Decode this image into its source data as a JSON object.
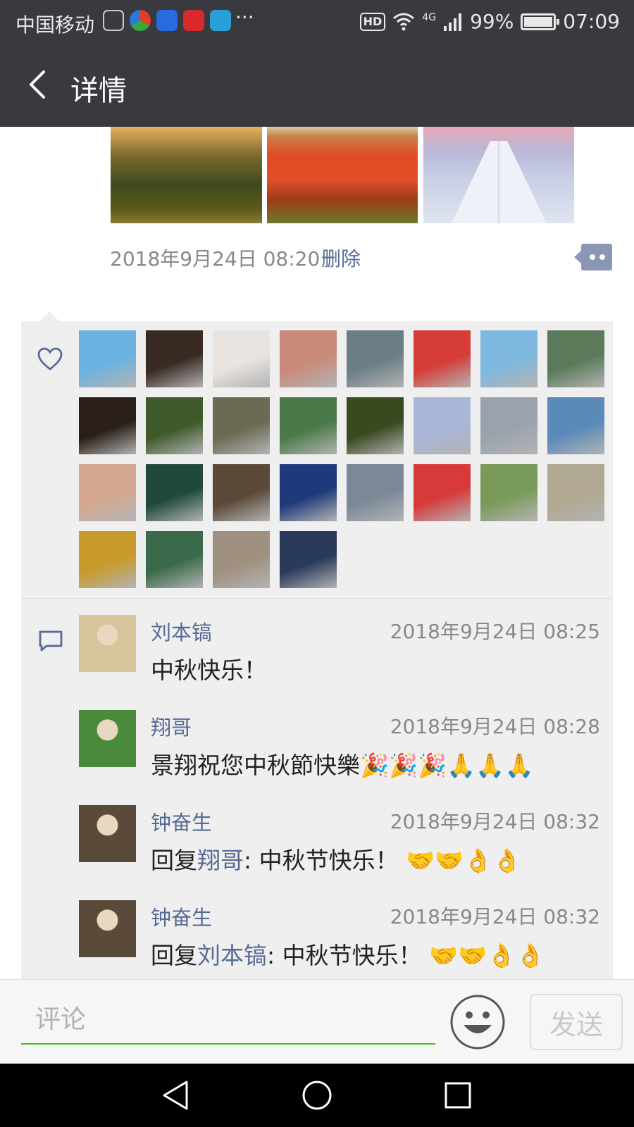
{
  "status_bar": {
    "carrier": "中国移动",
    "network_badge": "HD",
    "signal_label": "4G",
    "battery_percent": "99%",
    "battery_level": 0.99,
    "time": "07:09",
    "app_icons": [
      "vpn-icon",
      "browser-icon",
      "baidu-icon",
      "video-icon",
      "telegram-icon"
    ]
  },
  "header": {
    "title": "详情"
  },
  "moment": {
    "timestamp": "2018年9月24日 08:20",
    "delete_label": "删除"
  },
  "likes": {
    "avatars": [
      "#6ab3e0",
      "#3a2a24",
      "#e9e4e0",
      "#c98a7a",
      "#6b7d86",
      "#d63c38",
      "#7fb8de",
      "#5b7a5a",
      "#2a1f18",
      "#3f5a2a",
      "#6b6a55",
      "#4a7a4a",
      "#3a4a20",
      "#a9b6d8",
      "#9aa3ad",
      "#5a8ab8",
      "#d4a890",
      "#1f4a3a",
      "#5a4838",
      "#1e3a7a",
      "#7a8898",
      "#d83a3a",
      "#7a9a5a",
      "#b0a890",
      "#c89a2a",
      "#3a6a4a",
      "#a09080",
      "#2a3a5a"
    ]
  },
  "comments": [
    {
      "name": "刘本镐",
      "time": "2018年9月24日 08:25",
      "text": "中秋快乐！",
      "avatar_color": "#d8c49a"
    },
    {
      "name": "翔哥",
      "time": "2018年9月24日 08:28",
      "text": "景翔祝您中秋節快樂🎉🎉🎉🙏🙏🙏",
      "avatar_color": "#4a8a3a"
    },
    {
      "name": "钟奋生",
      "time": "2018年9月24日 08:32",
      "reply_prefix": "回复",
      "reply_to": "翔哥",
      "text": ": 中秋节快乐！ 🤝🤝👌👌",
      "avatar_color": "#5a4a3a"
    },
    {
      "name": "钟奋生",
      "time": "2018年9月24日 08:32",
      "reply_prefix": "回复",
      "reply_to": "刘本镐",
      "text": ": 中秋节快乐！ 🤝🤝👌👌",
      "avatar_color": "#5a4a3a"
    }
  ],
  "input_bar": {
    "placeholder": "评论",
    "send_label": "发送"
  },
  "colors": {
    "bar_dark": "#393a3f",
    "link_blue": "#576b95",
    "accent_green": "#45c01a",
    "panel_gray": "#efefef"
  }
}
